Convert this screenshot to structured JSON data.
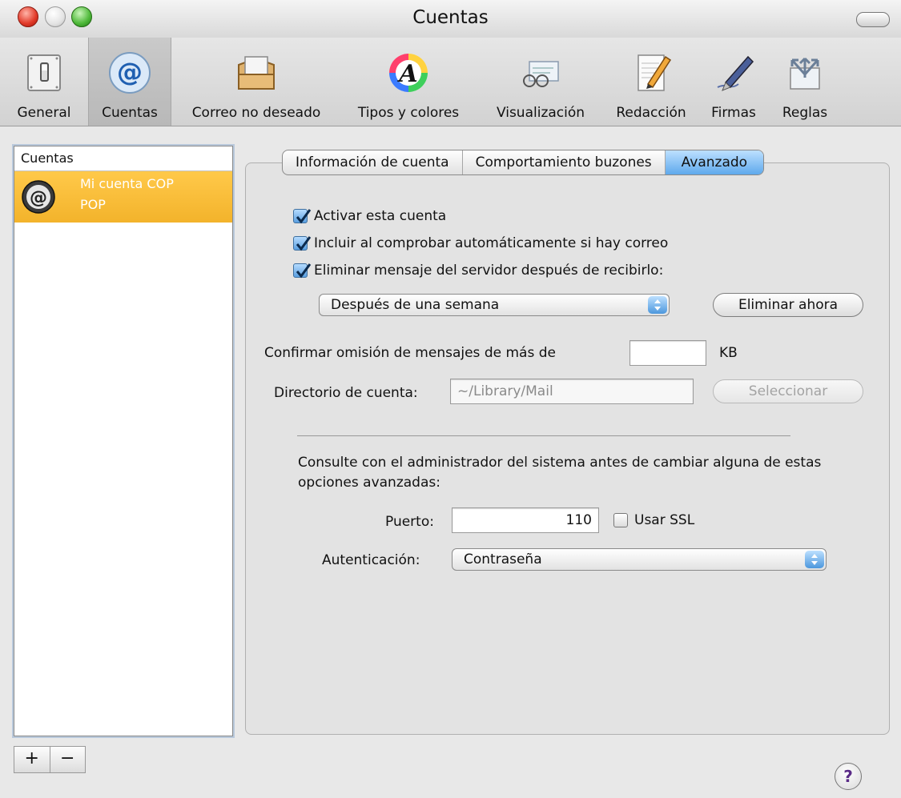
{
  "window": {
    "title": "Cuentas"
  },
  "toolbar": {
    "items": [
      {
        "label": "General",
        "icon": "light-switch-icon"
      },
      {
        "label": "Cuentas",
        "icon": "at-sign-icon",
        "selected": true
      },
      {
        "label": "Correo no deseado",
        "icon": "junk-mail-icon"
      },
      {
        "label": "Tipos y colores",
        "icon": "font-color-wheel-icon"
      },
      {
        "label": "Visualización",
        "icon": "glasses-letter-icon"
      },
      {
        "label": "Redacción",
        "icon": "pencil-paper-icon"
      },
      {
        "label": "Firmas",
        "icon": "fountain-pen-icon"
      },
      {
        "label": "Reglas",
        "icon": "rules-arrows-icon"
      }
    ]
  },
  "sidebar": {
    "header": "Cuentas",
    "accounts": [
      {
        "name": "Mi cuenta COP",
        "type": "POP",
        "selected": true
      }
    ],
    "add_label": "+",
    "remove_label": "−"
  },
  "tabs": [
    {
      "label": "Información de cuenta",
      "active": false
    },
    {
      "label": "Comportamiento buzones",
      "active": false
    },
    {
      "label": "Avanzado",
      "active": true
    }
  ],
  "advanced": {
    "enable_account": {
      "label": "Activar esta cuenta",
      "checked": true
    },
    "include_auto_check": {
      "label": "Incluir al comprobar automáticamente si hay correo",
      "checked": true
    },
    "delete_from_server": {
      "label": "Eliminar mensaje del servidor después de recibirlo:",
      "checked": true
    },
    "delete_schedule": {
      "value": "Después de una semana"
    },
    "delete_now_label": "Eliminar ahora",
    "confirm_size_label": "Confirmar omisión de mensajes de más de",
    "confirm_size_value": "",
    "confirm_size_unit": "KB",
    "account_dir_label": "Directorio de cuenta:",
    "account_dir_value": "~/Library/Mail",
    "select_label": "Seleccionar",
    "admin_note": "Consulte con el administrador del sistema antes de cambiar alguna de estas opciones avanzadas:",
    "port_label": "Puerto:",
    "port_value": "110",
    "ssl": {
      "label": "Usar SSL",
      "checked": false
    },
    "auth_label": "Autenticación:",
    "auth_value": "Contraseña"
  },
  "help_label": "?",
  "colors": {
    "selection": "#f3b32b",
    "tab_active": "#5ea9ec",
    "checkbox_on": "#5a9fe0"
  }
}
